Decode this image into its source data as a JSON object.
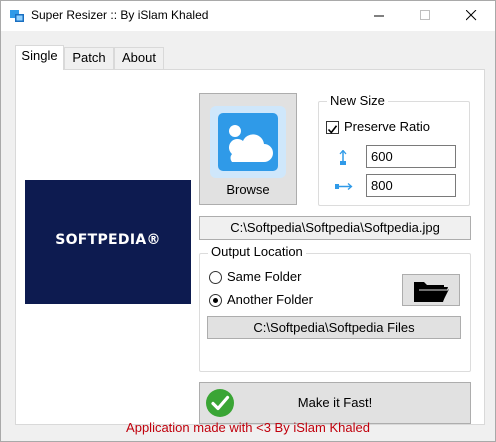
{
  "window": {
    "title": "Super Resizer :: By iSlam Khaled"
  },
  "tabs": [
    {
      "label": "Single",
      "active": true
    },
    {
      "label": "Patch",
      "active": false
    },
    {
      "label": "About",
      "active": false
    }
  ],
  "preview": {
    "logo_text": "SOFTPEDIA®"
  },
  "browse": {
    "label": "Browse",
    "icon": "image-icon"
  },
  "new_size": {
    "group_label": "New Size",
    "preserve_ratio_label": "Preserve Ratio",
    "preserve_ratio_checked": true,
    "height_value": "600",
    "width_value": "800"
  },
  "source_path": "C:\\Softpedia\\Softpedia\\Softpedia.jpg",
  "output_location": {
    "group_label": "Output Location",
    "same_folder_label": "Same Folder",
    "another_folder_label": "Another Folder",
    "selected": "another",
    "path": "C:\\Softpedia\\Softpedia Files"
  },
  "action": {
    "make_fast_label": "Make it Fast!"
  },
  "footer": {
    "text": "Application made with <3 By iSlam Khaled"
  },
  "colors": {
    "accent": "#2f9ae8",
    "footer": "#c0000c",
    "preview_bg": "#0d1b50",
    "check_green": "#3aa535"
  }
}
